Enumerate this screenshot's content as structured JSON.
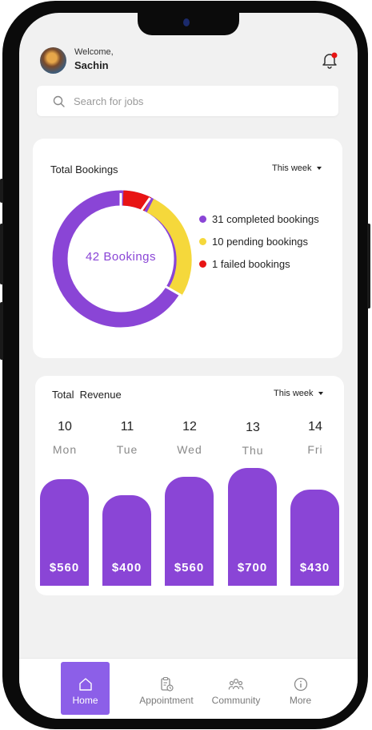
{
  "header": {
    "welcome": "Welcome,",
    "name": "Sachin"
  },
  "search": {
    "placeholder": "Search for jobs"
  },
  "bookings": {
    "title": "Total Bookings",
    "period": "This week",
    "center_label": "42 Bookings",
    "legend": [
      {
        "label": "31 completed bookings",
        "color": "#8a45d6"
      },
      {
        "label": "10 pending bookings",
        "color": "#f5d83b"
      },
      {
        "label": "1 failed bookings",
        "color": "#e81414"
      }
    ]
  },
  "revenue": {
    "title": "Total  Revenue",
    "period": "This week",
    "days": [
      {
        "num": "10",
        "name": "Mon",
        "amount": "$560"
      },
      {
        "num": "11",
        "name": "Tue",
        "amount": "$400"
      },
      {
        "num": "12",
        "name": "Wed",
        "amount": "$560"
      },
      {
        "num": "13",
        "name": "Thu",
        "amount": "$700"
      },
      {
        "num": "14",
        "name": "Fri",
        "amount": "$430"
      }
    ]
  },
  "nav": {
    "items": [
      {
        "label": "Home",
        "icon": "home-icon"
      },
      {
        "label": "Appointment",
        "icon": "clipboard-clock-icon"
      },
      {
        "label": "Community",
        "icon": "people-icon"
      },
      {
        "label": "More",
        "icon": "info-icon"
      }
    ]
  },
  "colors": {
    "accent": "#8a45d6",
    "pending": "#f5d83b",
    "failed": "#e81414",
    "nav_active": "#8c5fe8"
  }
}
